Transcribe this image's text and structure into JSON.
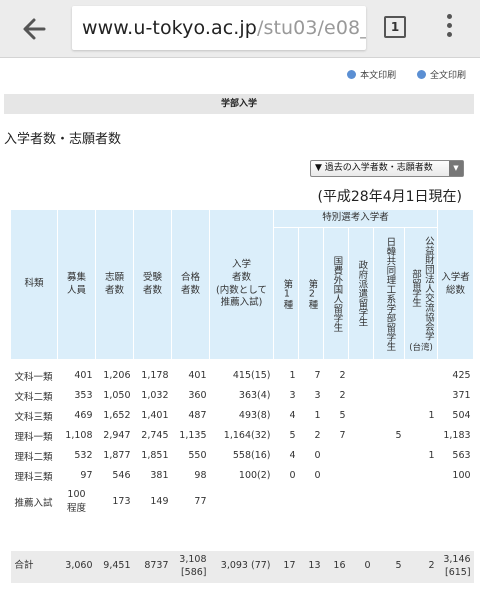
{
  "browser": {
    "url_host": "www.u-tokyo.ac.jp",
    "url_path": "/stu03/e08_",
    "tab_count": "1"
  },
  "print_links": {
    "body_print": "本文印刷",
    "full_print": "全文印刷"
  },
  "section_title": "学部入学",
  "page_heading": "入学者数・志願者数",
  "past_select": {
    "label": "▼ 過去の入学者数・志願者数",
    "options": []
  },
  "as_of": "(平成28年4月1日現在)",
  "table": {
    "headers": {
      "category": "科類",
      "quota": "募集人員",
      "applicants": "志願者数",
      "examinees": "受験者数",
      "passed": "合格者数",
      "enrolled": "入学者数",
      "enrolled_note": "(内数として推薦入試)",
      "special_group": "特別選考入学者",
      "type1": "第1種",
      "type2": "第2種",
      "govt_foreign": "国費外国人留学生",
      "govt_dispatched": "政府派遣留学生",
      "jk_program": "日韓共同理工系学部留学生",
      "foundation": "公益財団法人交流協会学部留学生",
      "foundation_note": "(台湾)",
      "total_enrolled": "入学者総数"
    },
    "rows": [
      {
        "category": "文科一類",
        "quota": "401",
        "applicants": "1,206",
        "examinees": "1,178",
        "passed": "401",
        "enrolled": "415(15)",
        "type1": "1",
        "type2": "7",
        "govt_foreign": "2",
        "govt_dispatched": "",
        "jk": "",
        "foundation": "",
        "total": "425"
      },
      {
        "category": "文科二類",
        "quota": "353",
        "applicants": "1,050",
        "examinees": "1,032",
        "passed": "360",
        "enrolled": "363(4)",
        "type1": "3",
        "type2": "3",
        "govt_foreign": "2",
        "govt_dispatched": "",
        "jk": "",
        "foundation": "",
        "total": "371"
      },
      {
        "category": "文科三類",
        "quota": "469",
        "applicants": "1,652",
        "examinees": "1,401",
        "passed": "487",
        "enrolled": "493(8)",
        "type1": "4",
        "type2": "1",
        "govt_foreign": "5",
        "govt_dispatched": "",
        "jk": "",
        "foundation": "1",
        "total": "504"
      },
      {
        "category": "理科一類",
        "quota": "1,108",
        "applicants": "2,947",
        "examinees": "2,745",
        "passed": "1,135",
        "enrolled": "1,164(32)",
        "type1": "5",
        "type2": "2",
        "govt_foreign": "7",
        "govt_dispatched": "",
        "jk": "5",
        "foundation": "",
        "total": "1,183"
      },
      {
        "category": "理科二類",
        "quota": "532",
        "applicants": "1,877",
        "examinees": "1,851",
        "passed": "550",
        "enrolled": "558(16)",
        "type1": "4",
        "type2": "0",
        "govt_foreign": "",
        "govt_dispatched": "",
        "jk": "",
        "foundation": "1",
        "total": "563"
      },
      {
        "category": "理科三類",
        "quota": "97",
        "applicants": "546",
        "examinees": "381",
        "passed": "98",
        "enrolled": "100(2)",
        "type1": "0",
        "type2": "0",
        "govt_foreign": "",
        "govt_dispatched": "",
        "jk": "",
        "foundation": "",
        "total": "100"
      }
    ],
    "recommend_row": {
      "category": "推薦入試",
      "quota_line1": "100",
      "quota_line2": "程度",
      "applicants": "173",
      "examinees": "149",
      "passed": "77"
    },
    "total_row": {
      "category": "合計",
      "quota": "3,060",
      "applicants": "9,451",
      "examinees": "8737",
      "passed_line1": "3,108",
      "passed_line2": "[586]",
      "enrolled": "3,093 (77)",
      "type1": "17",
      "type2": "13",
      "govt_foreign": "16",
      "govt_dispatched": "0",
      "jk": "5",
      "foundation": "2",
      "total_line1": "3,146",
      "total_line2": "[615]"
    }
  }
}
